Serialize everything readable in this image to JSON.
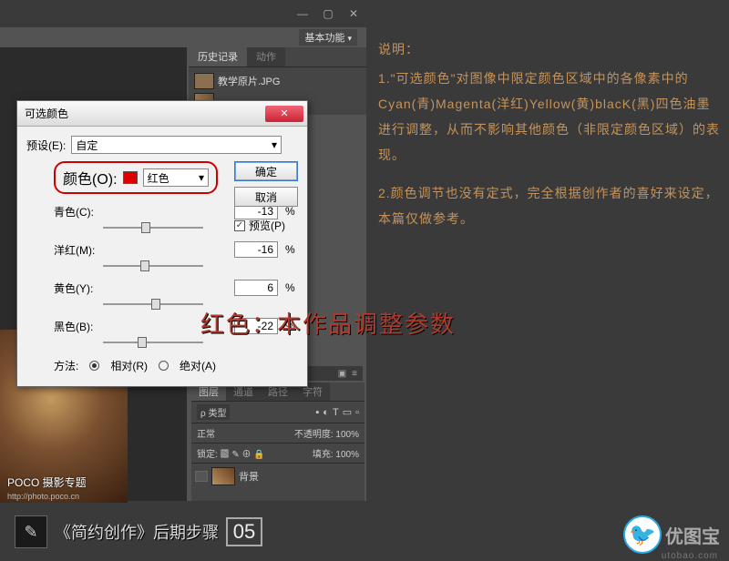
{
  "ps": {
    "workspace_label": "基本功能",
    "history": {
      "tab_active": "历史记录",
      "tab_inactive": "动作",
      "doc_label": "教学原片.JPG"
    }
  },
  "dialog": {
    "title": "可选颜色",
    "preset_label": "预设(E):",
    "preset_value": "自定",
    "ok": "确定",
    "cancel": "取消",
    "preview": "预览(P)",
    "color_label": "颜色(O):",
    "color_value": "红色",
    "sliders": {
      "cyan": {
        "label": "青色(C):",
        "value": "-13",
        "pct": "%"
      },
      "magenta": {
        "label": "洋红(M):",
        "value": "-16",
        "pct": "%"
      },
      "yellow": {
        "label": "黄色(Y):",
        "value": "6",
        "pct": "%"
      },
      "black": {
        "label": "黑色(B):",
        "value": "-22",
        "pct": "%"
      }
    },
    "method_label": "方法:",
    "method_relative": "相对(R)",
    "method_absolute": "绝对(A)"
  },
  "layers": {
    "tab1": "图层",
    "tab2": "通道",
    "tab3": "路径",
    "tab4": "字符",
    "kind_label": "ρ 类型",
    "blend_mode": "正常",
    "opacity_label": "不透明度:",
    "opacity_value": "100%",
    "lock_label": "锁定:",
    "fill_label": "填充:",
    "fill_value": "100%",
    "layer_name": "背景"
  },
  "poco": {
    "brand": "POCO 摄影专题",
    "url": "http://photo.poco.cn"
  },
  "explain": {
    "heading": "说明：",
    "p1": "1.\"可选颜色\"对图像中限定颜色区域中的各像素中的Cyan(青)Magenta(洋红)Yellow(黄)blacK(黑)四色油墨进行调整，从而不影响其他颜色（非限定颜色区域）的表现。",
    "p2": "2.颜色调节也没有定式，完全根据创作者的喜好来设定，本篇仅做参考。"
  },
  "red_caption": "红色：本作品调整参数",
  "bottom": {
    "title": "《简约创作》后期步骤",
    "step": "05"
  },
  "logo": {
    "name": "优图宝",
    "url": "utobao.com"
  }
}
